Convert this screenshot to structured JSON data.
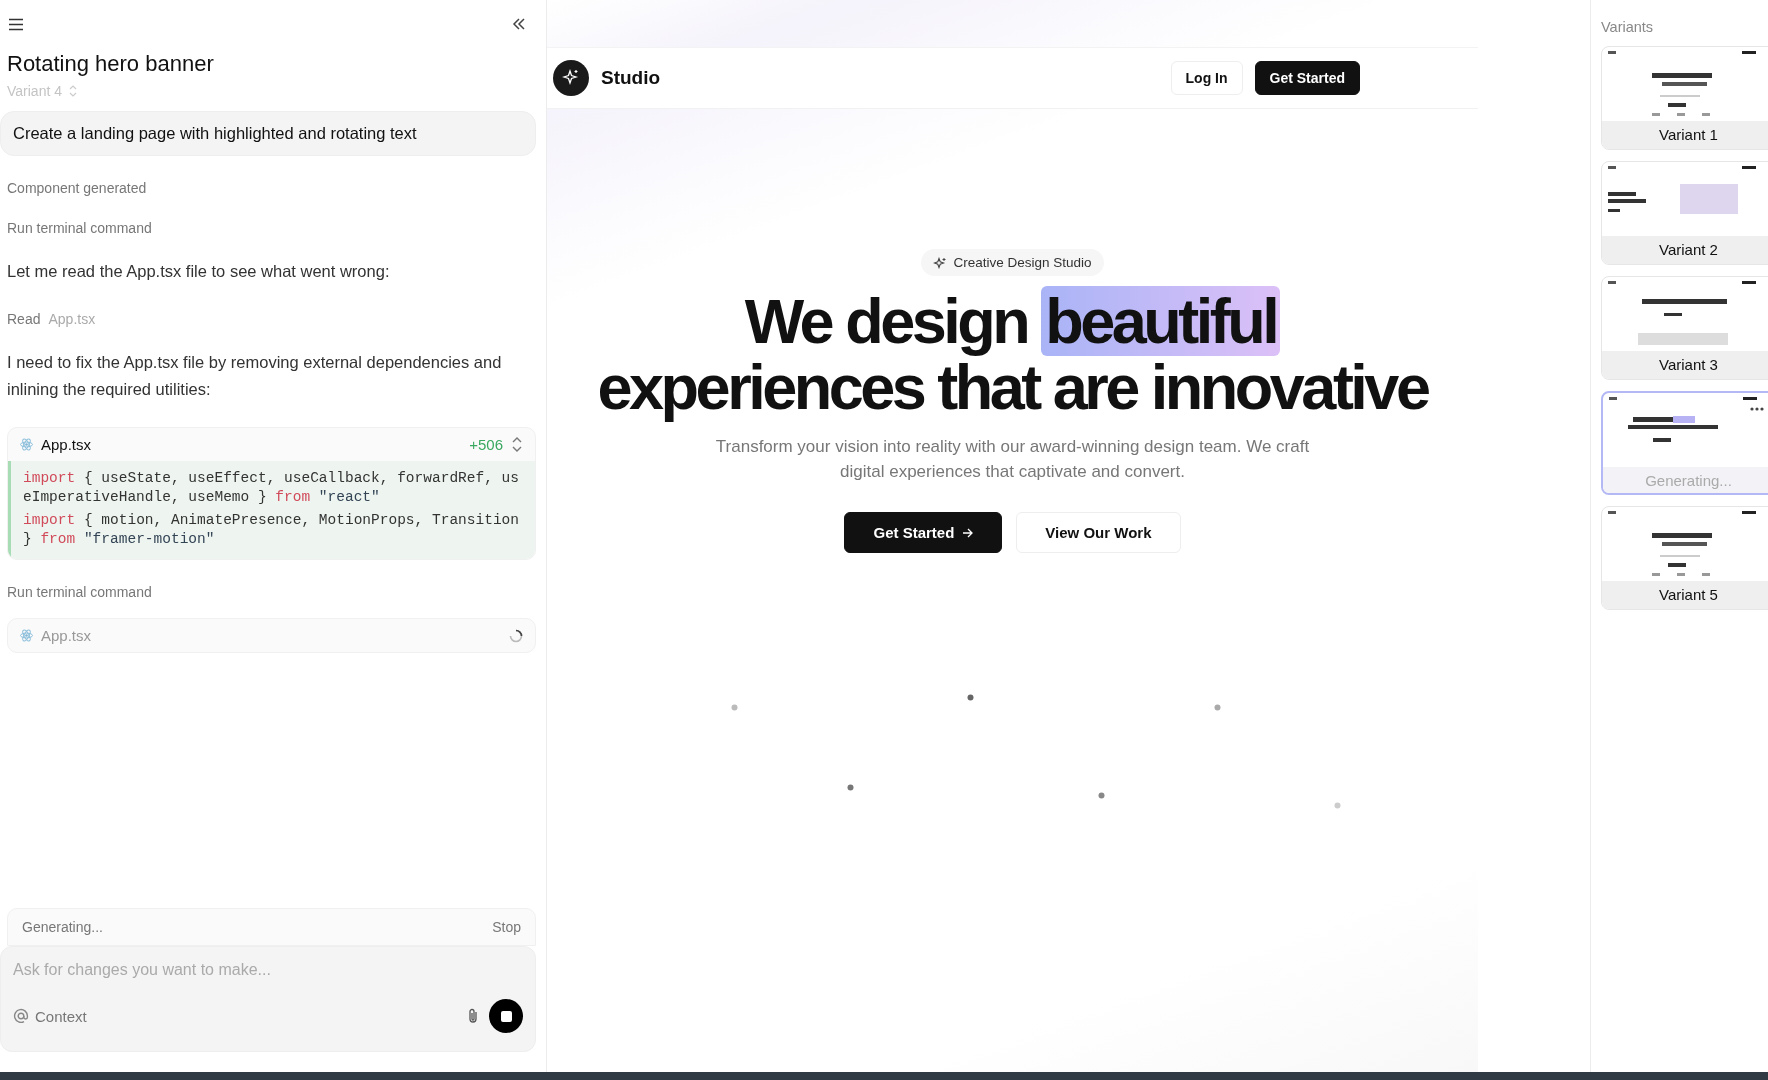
{
  "sidebar": {
    "title": "Rotating hero banner",
    "variant": "Variant 4",
    "prompt": "Create a landing page with highlighted and rotating text",
    "steps": [
      {
        "kind": "label",
        "text": "Component generated"
      },
      {
        "kind": "label",
        "text": "Run terminal command"
      },
      {
        "kind": "message",
        "text": "Let me read the App.tsx file to see what went wrong:"
      },
      {
        "kind": "read",
        "label": "Read",
        "file": "App.tsx"
      },
      {
        "kind": "message",
        "text": "I need to fix the App.tsx file by removing external dependencies and inlining the required utilities:"
      },
      {
        "kind": "file",
        "name": "App.tsx",
        "added": "+506",
        "lines": [
          [
            {
              "kind": "keyword",
              "text": "import"
            },
            {
              "kind": "plain",
              "text": " { useState, useEffect, useCallback, forwardRef, useImperativeHandle, useMemo } "
            },
            {
              "kind": "keyword",
              "text": "from"
            },
            {
              "kind": "string",
              "text": " \"react\""
            }
          ],
          [
            {
              "kind": "keyword",
              "text": "import"
            },
            {
              "kind": "plain",
              "text": " { motion, AnimatePresence, MotionProps, Transition } "
            },
            {
              "kind": "keyword",
              "text": "from"
            },
            {
              "kind": "string",
              "text": " \"framer-motion\""
            }
          ]
        ]
      },
      {
        "kind": "label",
        "text": "Run terminal command"
      },
      {
        "kind": "pending",
        "name": "App.tsx"
      }
    ],
    "status": {
      "text": "Generating...",
      "action": "Stop"
    },
    "input": {
      "placeholder": "Ask for changes you want to make...",
      "context": "Context"
    }
  },
  "preview": {
    "brand": "Studio",
    "nav": [
      {
        "label": "Log In",
        "kind": "secondary"
      },
      {
        "label": "Get Started",
        "kind": "primary"
      }
    ],
    "badge": "Creative Design Studio",
    "headline": {
      "before": "We design",
      "highlight": "beautiful",
      "after": "experiences that are innovative"
    },
    "subtitle": "Transform your vision into reality with our award-winning design team. We craft digital experiences that captivate and convert.",
    "buttons": [
      {
        "label": "Get Started",
        "kind": "primary"
      },
      {
        "label": "View Our Work",
        "kind": "secondary"
      }
    ]
  },
  "variants": {
    "title": "Variants",
    "items": [
      {
        "label": "Variant 1",
        "selected": false,
        "kind": "centered"
      },
      {
        "label": "Variant 2",
        "selected": false,
        "kind": "split"
      },
      {
        "label": "Variant 3",
        "selected": false,
        "kind": "media"
      },
      {
        "label": "Generating...",
        "selected": true,
        "kind": "highlight"
      },
      {
        "label": "Variant 5",
        "selected": false,
        "kind": "centered"
      }
    ]
  }
}
